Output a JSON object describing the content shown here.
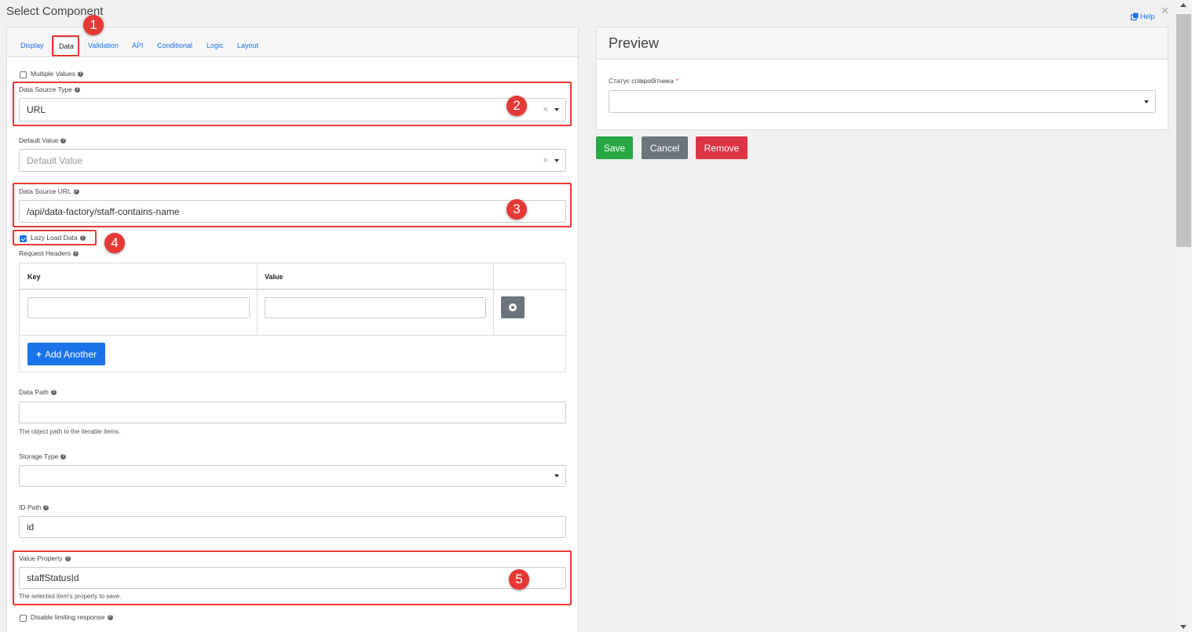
{
  "dialog": {
    "title": "Select Component",
    "help_label": "Help"
  },
  "tabs": [
    {
      "label": "Display"
    },
    {
      "label": "Data"
    },
    {
      "label": "Validation"
    },
    {
      "label": "API"
    },
    {
      "label": "Conditional"
    },
    {
      "label": "Logic"
    },
    {
      "label": "Layout"
    }
  ],
  "active_tab": "Data",
  "form": {
    "multiple_values": {
      "label": "Multiple Values",
      "checked": false
    },
    "data_source_type": {
      "label": "Data Source Type",
      "value": "URL"
    },
    "default_value": {
      "label": "Default Value",
      "placeholder": "Default Value"
    },
    "data_source_url": {
      "label": "Data Source URL",
      "value": "/api/data-factory/staff-contains-name"
    },
    "lazy_load": {
      "label": "Lazy Load Data",
      "checked": true
    },
    "request_headers": {
      "label": "Request Headers",
      "col_key": "Key",
      "col_value": "Value",
      "add_label": "Add Another"
    },
    "data_path": {
      "label": "Data Path",
      "value": "",
      "description": "The object path to the iterable items."
    },
    "storage_type": {
      "label": "Storage Type",
      "value": ""
    },
    "id_path": {
      "label": "ID Path",
      "value": "id"
    },
    "value_property": {
      "label": "Value Property",
      "value": "staffStatusId",
      "description": "The selected item's property to save."
    },
    "disable_limiting": {
      "label": "Disable limiting response",
      "checked": false
    }
  },
  "preview": {
    "title": "Preview",
    "field_label": "Статус співробітника",
    "required_mark": "*"
  },
  "actions": {
    "save": "Save",
    "cancel": "Cancel",
    "remove": "Remove"
  },
  "annotations": [
    "1",
    "2",
    "3",
    "4",
    "5"
  ],
  "colors": {
    "accent": "#1a73e8",
    "save": "#28a745",
    "cancel": "#6c757d",
    "remove": "#dc3545",
    "highlight": "#e53935"
  }
}
